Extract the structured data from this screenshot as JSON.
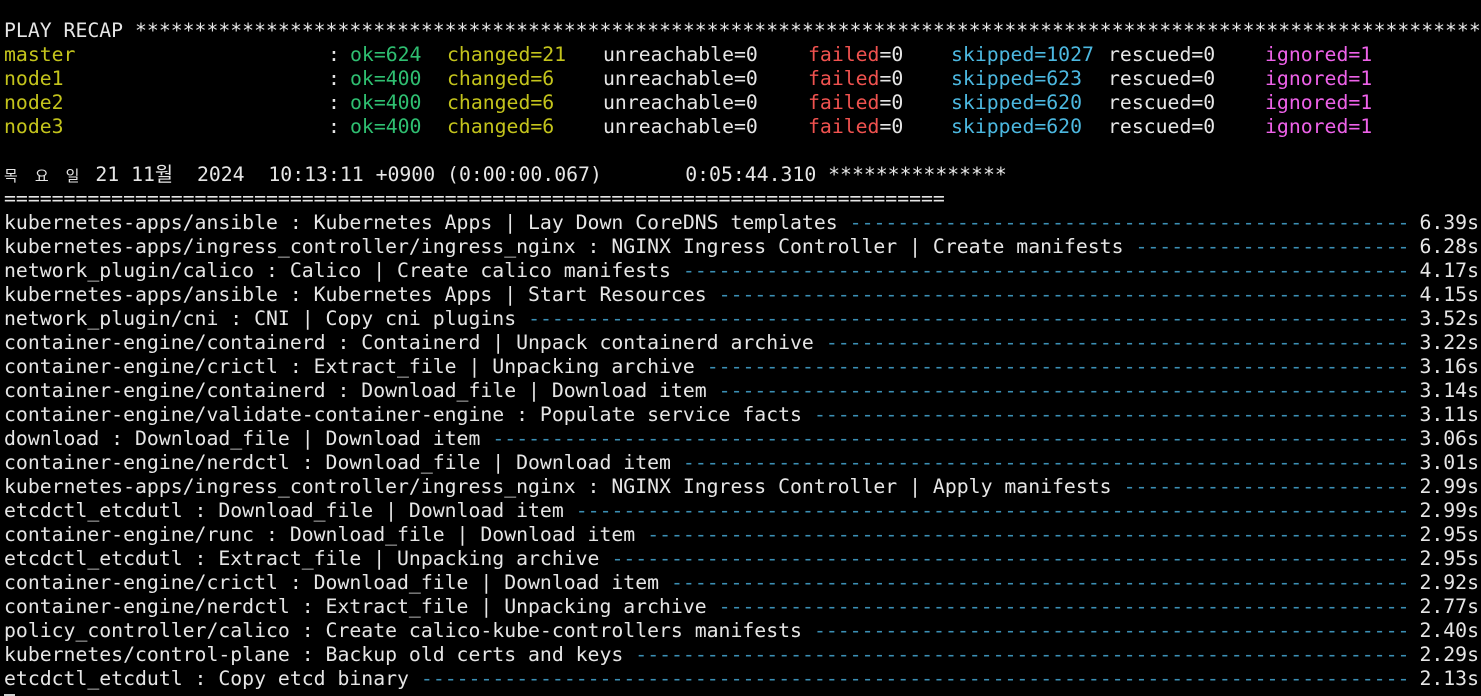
{
  "colors": {
    "background": "#000000",
    "text": "#e6e6e6",
    "host": "#c4c41c",
    "ok": "#2fbf71",
    "changed": "#c4c41c",
    "failed": "#f0524f",
    "skipped": "#4cb8e0",
    "ignored": "#ee62e9",
    "dashes": "#3b8fb5"
  },
  "recap": {
    "header": "PLAY RECAP ************************************************************************************************************************************************************************************",
    "hosts": [
      {
        "name": "master",
        "ok": "ok=624",
        "changed": "changed=21",
        "unreachable": "unreachable=0",
        "failed_label": "failed",
        "failed_value": "=0",
        "skipped": "skipped=1027",
        "rescued": "rescued=0",
        "ignored": "ignored=1"
      },
      {
        "name": "node1",
        "ok": "ok=400",
        "changed": "changed=6",
        "unreachable": "unreachable=0",
        "failed_label": "failed",
        "failed_value": "=0",
        "skipped": "skipped=623",
        "rescued": "rescued=0",
        "ignored": "ignored=1"
      },
      {
        "name": "node2",
        "ok": "ok=400",
        "changed": "changed=6",
        "unreachable": "unreachable=0",
        "failed_label": "failed",
        "failed_value": "=0",
        "skipped": "skipped=620",
        "rescued": "rescued=0",
        "ignored": "ignored=1"
      },
      {
        "name": "node3",
        "ok": "ok=400",
        "changed": "changed=6",
        "unreachable": "unreachable=0",
        "failed_label": "failed",
        "failed_value": "=0",
        "skipped": "skipped=620",
        "rescued": "rescued=0",
        "ignored": "ignored=1"
      }
    ],
    "colon": ":"
  },
  "summary": {
    "day": "목 요 일",
    "datetime": " 21 11월  2024  10:13:11 +0900 (0:00:00.067)       0:05:44.310 ***************",
    "separator": "==============================================================================="
  },
  "tasks": [
    {
      "name": "kubernetes-apps/ansible : Kubernetes Apps | Lay Down CoreDNS templates",
      "time": "6.39s"
    },
    {
      "name": "kubernetes-apps/ingress_controller/ingress_nginx : NGINX Ingress Controller | Create manifests",
      "time": "6.28s"
    },
    {
      "name": "network_plugin/calico : Calico | Create calico manifests",
      "time": "4.17s"
    },
    {
      "name": "kubernetes-apps/ansible : Kubernetes Apps | Start Resources",
      "time": "4.15s"
    },
    {
      "name": "network_plugin/cni : CNI | Copy cni plugins",
      "time": "3.52s"
    },
    {
      "name": "container-engine/containerd : Containerd | Unpack containerd archive",
      "time": "3.22s"
    },
    {
      "name": "container-engine/crictl : Extract_file | Unpacking archive",
      "time": "3.16s"
    },
    {
      "name": "container-engine/containerd : Download_file | Download item",
      "time": "3.14s"
    },
    {
      "name": "container-engine/validate-container-engine : Populate service facts",
      "time": "3.11s"
    },
    {
      "name": "download : Download_file | Download item",
      "time": "3.06s"
    },
    {
      "name": "container-engine/nerdctl : Download_file | Download item",
      "time": "3.01s"
    },
    {
      "name": "kubernetes-apps/ingress_controller/ingress_nginx : NGINX Ingress Controller | Apply manifests",
      "time": "2.99s"
    },
    {
      "name": "etcdctl_etcdutl : Download_file | Download item",
      "time": "2.99s"
    },
    {
      "name": "container-engine/runc : Download_file | Download item",
      "time": "2.95s"
    },
    {
      "name": "etcdctl_etcdutl : Extract_file | Unpacking archive",
      "time": "2.95s"
    },
    {
      "name": "container-engine/crictl : Download_file | Download item",
      "time": "2.92s"
    },
    {
      "name": "container-engine/nerdctl : Extract_file | Unpacking archive",
      "time": "2.77s"
    },
    {
      "name": "policy_controller/calico : Create calico-kube-controllers manifests",
      "time": "2.40s"
    },
    {
      "name": "kubernetes/control-plane : Backup old certs and keys",
      "time": "2.29s"
    },
    {
      "name": "etcdctl_etcdutl : Copy etcd binary",
      "time": "2.13s"
    }
  ]
}
